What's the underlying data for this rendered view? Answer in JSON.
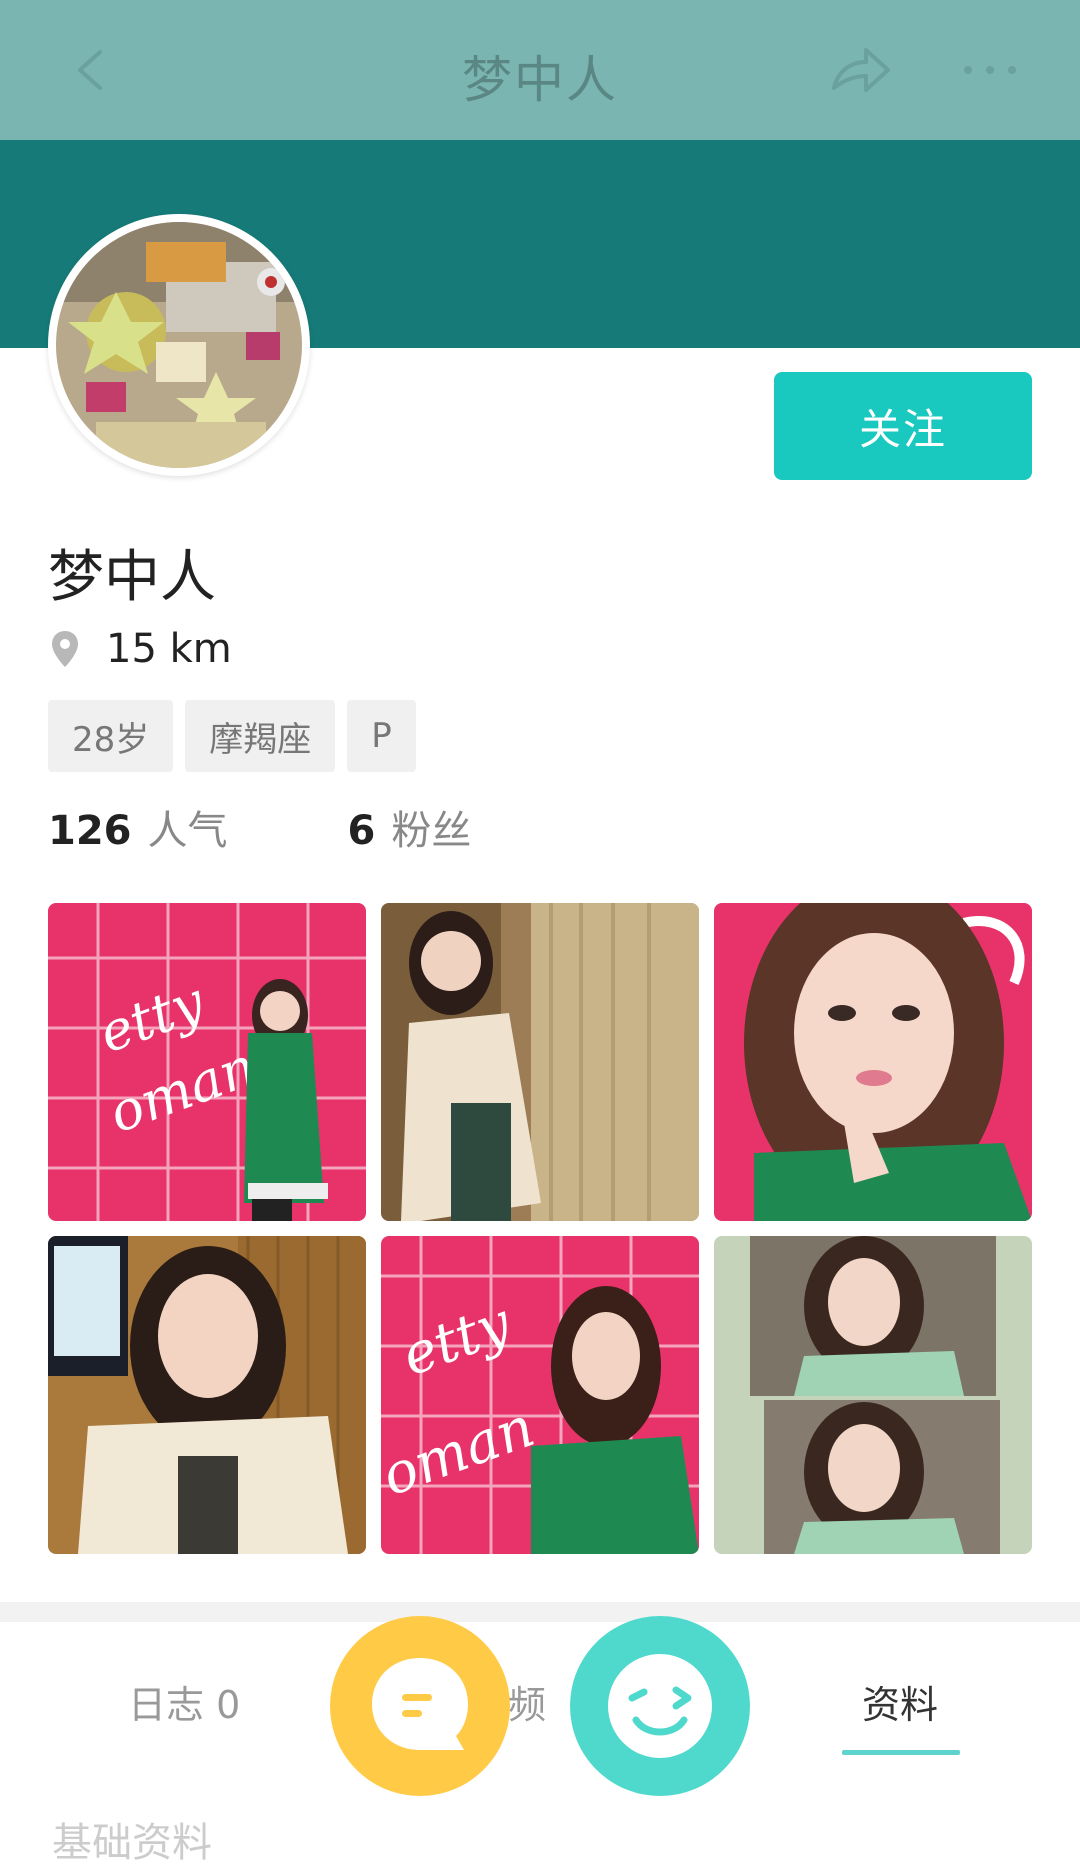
{
  "nav": {
    "title": "梦中人",
    "back_icon": "back-arrow-icon",
    "share_icon": "share-icon",
    "more_icon": "more-dots-icon"
  },
  "profile": {
    "name": "梦中人",
    "distance": "15 km",
    "follow_label": "关注",
    "tags": [
      "28岁",
      "摩羯座",
      "P"
    ],
    "stats": {
      "popularity_value": "126",
      "popularity_label": "人气",
      "fans_value": "6",
      "fans_label": "粉丝"
    }
  },
  "photos": [
    {
      "name": "photo-1"
    },
    {
      "name": "photo-2"
    },
    {
      "name": "photo-3"
    },
    {
      "name": "photo-4"
    },
    {
      "name": "photo-5"
    },
    {
      "name": "photo-6"
    }
  ],
  "tabs": [
    {
      "label": "日志 0"
    },
    {
      "label": "视频"
    },
    {
      "label": "资料",
      "active": true
    }
  ],
  "section_title": "基础资料",
  "colors": {
    "nav": "#7ab5b2",
    "banner": "#167b78",
    "accent": "#19c8bf",
    "chat_fab": "#ffca45",
    "smile_fab": "#4fd9cc"
  }
}
